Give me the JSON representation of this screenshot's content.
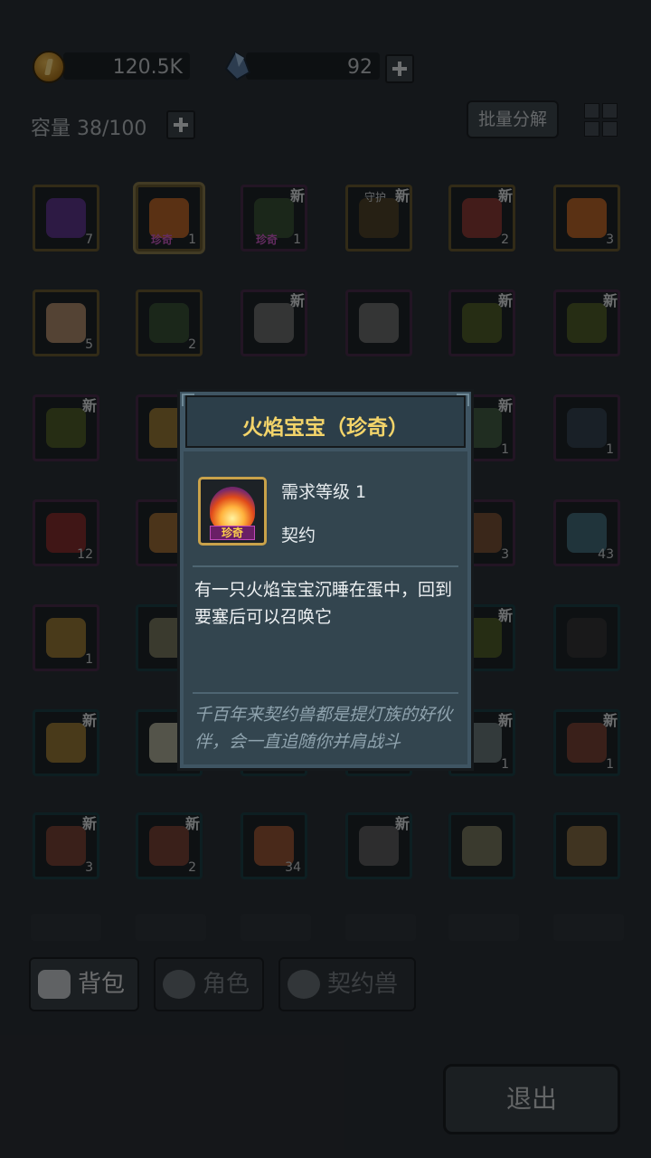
{
  "currency": {
    "gold": "120.5K",
    "crystals": "92"
  },
  "inventory": {
    "capacity_label": "容量 38/100",
    "batch_decompose": "批量分解",
    "new_badge": "新",
    "rare_tag": "珍奇",
    "guard_tag": "守护",
    "rows": [
      [
        {
          "icon": "purple-gem-icon",
          "count": "7",
          "rarity": "gold",
          "new": false
        },
        {
          "icon": "fire-egg-icon",
          "count": "1",
          "rarity": "gold",
          "new": false,
          "rare": true,
          "selected": true
        },
        {
          "icon": "green-egg-icon",
          "count": "1",
          "rarity": "purple",
          "new": true,
          "rare": true
        },
        {
          "icon": "guard-armor-icon",
          "count": "",
          "rarity": "gold",
          "new": true,
          "guard": true
        },
        {
          "icon": "meat-icon",
          "count": "2",
          "rarity": "gold",
          "new": true
        },
        {
          "icon": "fire-egg-icon",
          "count": "3",
          "rarity": "gold",
          "new": false
        }
      ],
      [
        {
          "icon": "spotted-egg-icon",
          "count": "5",
          "rarity": "gold",
          "new": false
        },
        {
          "icon": "green-egg-icon",
          "count": "2",
          "rarity": "gold",
          "new": false
        },
        {
          "icon": "sword-icon",
          "count": "",
          "rarity": "purple",
          "new": true
        },
        {
          "icon": "sword-icon",
          "count": "",
          "rarity": "purple",
          "new": false
        },
        {
          "icon": "boots-icon",
          "count": "",
          "rarity": "purple",
          "new": true
        },
        {
          "icon": "boots-icon",
          "count": "",
          "rarity": "purple",
          "new": true
        }
      ],
      [
        {
          "icon": "boots-icon",
          "count": "",
          "rarity": "purple",
          "new": true
        },
        {
          "icon": "ring-icon",
          "count": "",
          "rarity": "purple",
          "new": false
        },
        {
          "icon": "empty",
          "count": "",
          "rarity": "purple",
          "new": false
        },
        {
          "icon": "empty",
          "count": "",
          "rarity": "purple",
          "new": false
        },
        {
          "icon": "leaf-icon",
          "count": "1",
          "rarity": "purple",
          "new": true
        },
        {
          "icon": "ore-icon",
          "count": "1",
          "rarity": "purple",
          "new": false
        }
      ],
      [
        {
          "icon": "potion-icon",
          "count": "12",
          "rarity": "purple",
          "new": false
        },
        {
          "icon": "bread-icon",
          "count": "",
          "rarity": "purple",
          "new": false
        },
        {
          "icon": "empty",
          "count": "",
          "rarity": "purple",
          "new": false
        },
        {
          "icon": "empty",
          "count": "",
          "rarity": "purple",
          "new": false
        },
        {
          "icon": "crystal-icon",
          "count": "3",
          "rarity": "purple",
          "new": false
        },
        {
          "icon": "cloth-icon",
          "count": "43",
          "rarity": "purple",
          "new": false
        }
      ],
      [
        {
          "icon": "key-icon",
          "count": "1",
          "rarity": "purple",
          "new": false
        },
        {
          "icon": "feather-icon",
          "count": "",
          "rarity": "teal",
          "new": false
        },
        {
          "icon": "empty",
          "count": "",
          "rarity": "teal",
          "new": false
        },
        {
          "icon": "empty",
          "count": "",
          "rarity": "teal",
          "new": false
        },
        {
          "icon": "boots-icon",
          "count": "",
          "rarity": "teal",
          "new": true
        },
        {
          "icon": "cloak-icon",
          "count": "",
          "rarity": "teal",
          "new": false
        }
      ],
      [
        {
          "icon": "ring-icon",
          "count": "",
          "rarity": "teal",
          "new": true
        },
        {
          "icon": "fang-icon",
          "count": "",
          "rarity": "teal",
          "new": false
        },
        {
          "icon": "empty",
          "count": "",
          "rarity": "teal",
          "new": false
        },
        {
          "icon": "empty",
          "count": "",
          "rarity": "teal",
          "new": false
        },
        {
          "icon": "horn-icon",
          "count": "1",
          "rarity": "teal",
          "new": true
        },
        {
          "icon": "bell-collar-icon",
          "count": "1",
          "rarity": "teal",
          "new": true
        }
      ],
      [
        {
          "icon": "bell-collar-icon",
          "count": "3",
          "rarity": "teal",
          "new": true
        },
        {
          "icon": "bell-collar-icon",
          "count": "2",
          "rarity": "teal",
          "new": true
        },
        {
          "icon": "ham-icon",
          "count": "34",
          "rarity": "teal",
          "new": false
        },
        {
          "icon": "hammer-icon",
          "count": "",
          "rarity": "teal",
          "new": true
        },
        {
          "icon": "feather-icon",
          "count": "",
          "rarity": "teal",
          "new": false
        },
        {
          "icon": "scroll-icon",
          "count": "",
          "rarity": "teal",
          "new": false
        }
      ]
    ]
  },
  "tabs": [
    {
      "label": "背包",
      "icon": "bag-icon",
      "active": true
    },
    {
      "label": "角色",
      "icon": "character-icon",
      "active": false
    },
    {
      "label": "契约兽",
      "icon": "paw-icon",
      "active": false
    }
  ],
  "exit_label": "退出",
  "dialog": {
    "title": "火焰宝宝（珍奇）",
    "rare_tag": "珍奇",
    "requirement": "需求等级 1",
    "item_type": "契约",
    "description": "有一只火焰宝宝沉睡在蛋中，回到要塞后可以召唤它",
    "flavor": "千百年来契约兽都是提灯族的好伙伴，会一直追随你并肩战斗"
  },
  "colors": {
    "title_gold": "#f3d46a",
    "rare_magenta": "#d05cc8",
    "dialog_bg": "#33454f"
  }
}
